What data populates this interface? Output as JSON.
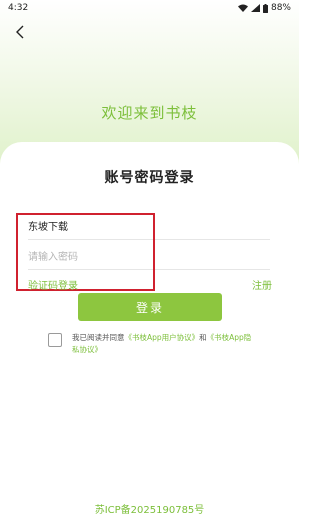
{
  "status_bar": {
    "time": "4:32",
    "battery": "88%"
  },
  "header": {
    "back_icon": "chevron-left-icon"
  },
  "welcome_text": "欢迎来到书枝",
  "login": {
    "title": "账号密码登录",
    "account_value": "东坡下载",
    "password_placeholder": "请输入密码",
    "verify_link": "验证码登录",
    "register_link": "注册",
    "login_button": "登录"
  },
  "agreement": {
    "prefix": "我已阅读并同意",
    "user_agreement": "《书枝App用户协议》",
    "and": "和",
    "privacy_policy": "《书枝App隐私协议》"
  },
  "footer": {
    "icp": "苏ICP备2025190785号"
  },
  "colors": {
    "accent": "#8dc63f",
    "link": "#7cbf3a",
    "highlight": "#d0212f"
  }
}
